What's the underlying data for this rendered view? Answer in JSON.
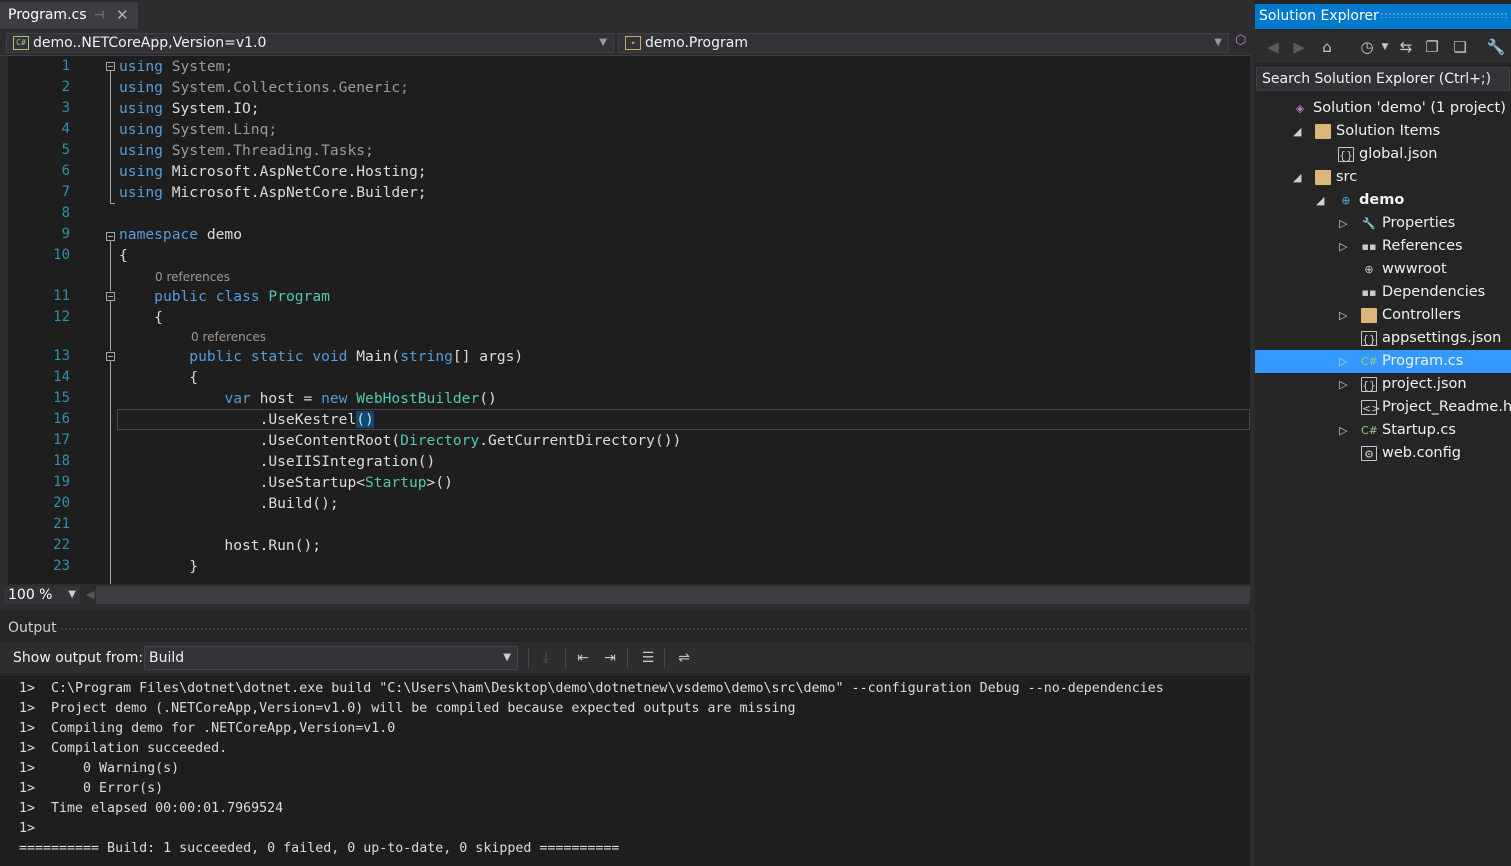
{
  "editor": {
    "tab_title": "Program.cs",
    "nav_project": "demo..NETCoreApp,Version=v1.0",
    "nav_type": "demo.Program",
    "code_lines": [
      {
        "n": "1",
        "text": "using System;",
        "kind": "using-gray"
      },
      {
        "n": "2",
        "text": "using System.Collections.Generic;",
        "kind": "using-gray"
      },
      {
        "n": "3",
        "text": "using System.IO;",
        "kind": "using"
      },
      {
        "n": "4",
        "text": "using System.Linq;",
        "kind": "using-gray"
      },
      {
        "n": "5",
        "text": "using System.Threading.Tasks;",
        "kind": "using-gray"
      },
      {
        "n": "6",
        "text": "using Microsoft.AspNetCore.Hosting;",
        "kind": "using"
      },
      {
        "n": "7",
        "text": "using Microsoft.AspNetCore.Builder;",
        "kind": "using"
      },
      {
        "n": "8",
        "text": "",
        "kind": "plain"
      },
      {
        "n": "9",
        "text": "namespace demo",
        "kind": "namespace"
      },
      {
        "n": "10",
        "text": "{",
        "kind": "plain"
      },
      {
        "n": "11",
        "text": "    public class Program",
        "kind": "class"
      },
      {
        "n": "12",
        "text": "    {",
        "kind": "plain"
      },
      {
        "n": "13",
        "text": "        public static void Main(string[] args)",
        "kind": "method"
      },
      {
        "n": "14",
        "text": "        {",
        "kind": "plain"
      },
      {
        "n": "15",
        "text": "            var host = new WebHostBuilder()",
        "kind": "var"
      },
      {
        "n": "16",
        "text": "                .UseKestrel()",
        "kind": "kestrel"
      },
      {
        "n": "17",
        "text": "                .UseContentRoot(Directory.GetCurrentDirectory())",
        "kind": "contentroot"
      },
      {
        "n": "18",
        "text": "                .UseIISIntegration()",
        "kind": "plain"
      },
      {
        "n": "19",
        "text": "                .UseStartup<Startup>()",
        "kind": "startup"
      },
      {
        "n": "20",
        "text": "                .Build();",
        "kind": "plain"
      },
      {
        "n": "21",
        "text": "",
        "kind": "plain"
      },
      {
        "n": "22",
        "text": "            host.Run();",
        "kind": "plain"
      },
      {
        "n": "23",
        "text": "        }",
        "kind": "plain"
      }
    ],
    "refs_class": "0 references",
    "refs_main": "0 references",
    "zoom": "100 %"
  },
  "output": {
    "title": "Output",
    "show_from_label": "Show output from:",
    "source": "Build",
    "lines": [
      "1>  C:\\Program Files\\dotnet\\dotnet.exe build \"C:\\Users\\ham\\Desktop\\demo\\dotnetnew\\vsdemo\\demo\\src\\demo\" --configuration Debug --no-dependencies",
      "1>  Project demo (.NETCoreApp,Version=v1.0) will be compiled because expected outputs are missing",
      "1>  Compiling demo for .NETCoreApp,Version=v1.0",
      "1>  Compilation succeeded.",
      "1>      0 Warning(s)",
      "1>      0 Error(s)",
      "1>  Time elapsed 00:00:01.7969524",
      "1>",
      "========== Build: 1 succeeded, 0 failed, 0 up-to-date, 0 skipped =========="
    ]
  },
  "solution_explorer": {
    "title": "Solution Explorer",
    "search_placeholder": "Search Solution Explorer (Ctrl+;)",
    "items": [
      {
        "label": "Solution 'demo' (1 project)",
        "depth": 0,
        "icon": "solution-icon",
        "expander": ""
      },
      {
        "label": "Solution Items",
        "depth": 1,
        "icon": "folder-icon",
        "expander": "◢"
      },
      {
        "label": "global.json",
        "depth": 2,
        "icon": "json-file-icon",
        "expander": ""
      },
      {
        "label": "src",
        "depth": 1,
        "icon": "folder-icon",
        "expander": "◢"
      },
      {
        "label": "demo",
        "depth": 2,
        "icon": "web-project-icon",
        "expander": "◢"
      },
      {
        "label": "Properties",
        "depth": 3,
        "icon": "wrench-icon",
        "expander": "▷"
      },
      {
        "label": "References",
        "depth": 3,
        "icon": "references-icon",
        "expander": "▷"
      },
      {
        "label": "wwwroot",
        "depth": 3,
        "icon": "globe-folder-icon",
        "expander": ""
      },
      {
        "label": "Dependencies",
        "depth": 3,
        "icon": "dependencies-icon",
        "expander": ""
      },
      {
        "label": "Controllers",
        "depth": 3,
        "icon": "folder-icon",
        "expander": "▷"
      },
      {
        "label": "appsettings.json",
        "depth": 3,
        "icon": "json-file-icon",
        "expander": ""
      },
      {
        "label": "Program.cs",
        "depth": 3,
        "icon": "csharp-file-icon",
        "expander": "▷"
      },
      {
        "label": "project.json",
        "depth": 3,
        "icon": "json-file-icon",
        "expander": "▷"
      },
      {
        "label": "Project_Readme.html",
        "depth": 3,
        "icon": "html-file-icon",
        "expander": ""
      },
      {
        "label": "Startup.cs",
        "depth": 3,
        "icon": "csharp-file-icon",
        "expander": "▷"
      },
      {
        "label": "web.config",
        "depth": 3,
        "icon": "config-file-icon",
        "expander": ""
      }
    ]
  },
  "colors": {
    "accent": "#007acc",
    "selection": "#3399ff",
    "keyword": "#569cd6",
    "type": "#4ec9b0",
    "line_number": "#2b91af"
  }
}
